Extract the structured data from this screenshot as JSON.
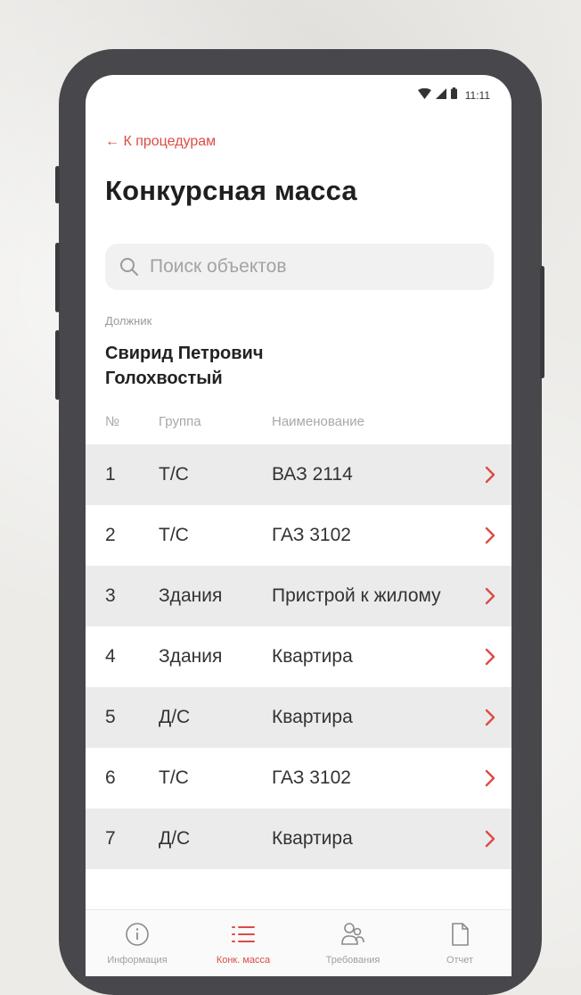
{
  "status_bar": {
    "time": "11:11"
  },
  "header": {
    "back_label": "← К процедурам",
    "title": "Конкурсная масса"
  },
  "search": {
    "placeholder": "Поиск объектов"
  },
  "debtor": {
    "label": "Должник",
    "name": "Свирид Петрович Голохвостый"
  },
  "table": {
    "columns": [
      "№",
      "Группа",
      "Наименование"
    ],
    "rows": [
      {
        "no": "1",
        "group": "Т/С",
        "name": "ВАЗ 2114"
      },
      {
        "no": "2",
        "group": "Т/С",
        "name": "ГАЗ 3102"
      },
      {
        "no": "3",
        "group": "Здания",
        "name": "Пристрой к жилому"
      },
      {
        "no": "4",
        "group": "Здания",
        "name": "Квартира"
      },
      {
        "no": "5",
        "group": "Д/С",
        "name": "Квартира"
      },
      {
        "no": "6",
        "group": "Т/С",
        "name": "ГАЗ 3102"
      },
      {
        "no": "7",
        "group": "Д/С",
        "name": "Квартира"
      }
    ]
  },
  "bottom_nav": {
    "items": [
      {
        "label": "Информация",
        "icon": "info-icon"
      },
      {
        "label": "Конк. масса",
        "icon": "list-icon",
        "active": true
      },
      {
        "label": "Требования",
        "icon": "users-icon"
      },
      {
        "label": "Отчет",
        "icon": "document-icon"
      }
    ]
  },
  "colors": {
    "accent": "#dc4b44",
    "phone_frame": "#48474c",
    "row_shade": "#ebebeb"
  }
}
